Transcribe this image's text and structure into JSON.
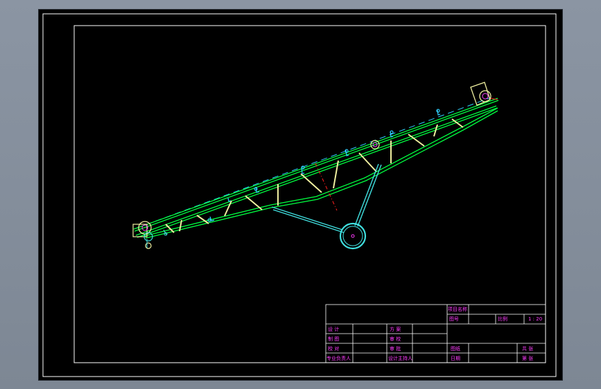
{
  "title_block": {
    "project_name": "项目名称",
    "drawing_no": "图号",
    "scale_label": "比例",
    "scale_value": "1 : 20",
    "designed": "设 计",
    "drawn": "制 图",
    "checked": "校 对",
    "major_leader": "专业负责人",
    "scheme": "方 案",
    "review": "审 校",
    "audit": "审 批",
    "design_leader": "设计主持人",
    "drawing_name": "图纸",
    "date": "日期",
    "total": "共 张",
    "sheet": "第 张"
  },
  "colors": {
    "frame": "#ffffff",
    "belt": "#00ff40",
    "structure": "#f0f0a0",
    "support": "#40e0e0",
    "centerline": "#30d0ff",
    "annotation": "#ff3cff",
    "section_mark": "#ff2020"
  }
}
